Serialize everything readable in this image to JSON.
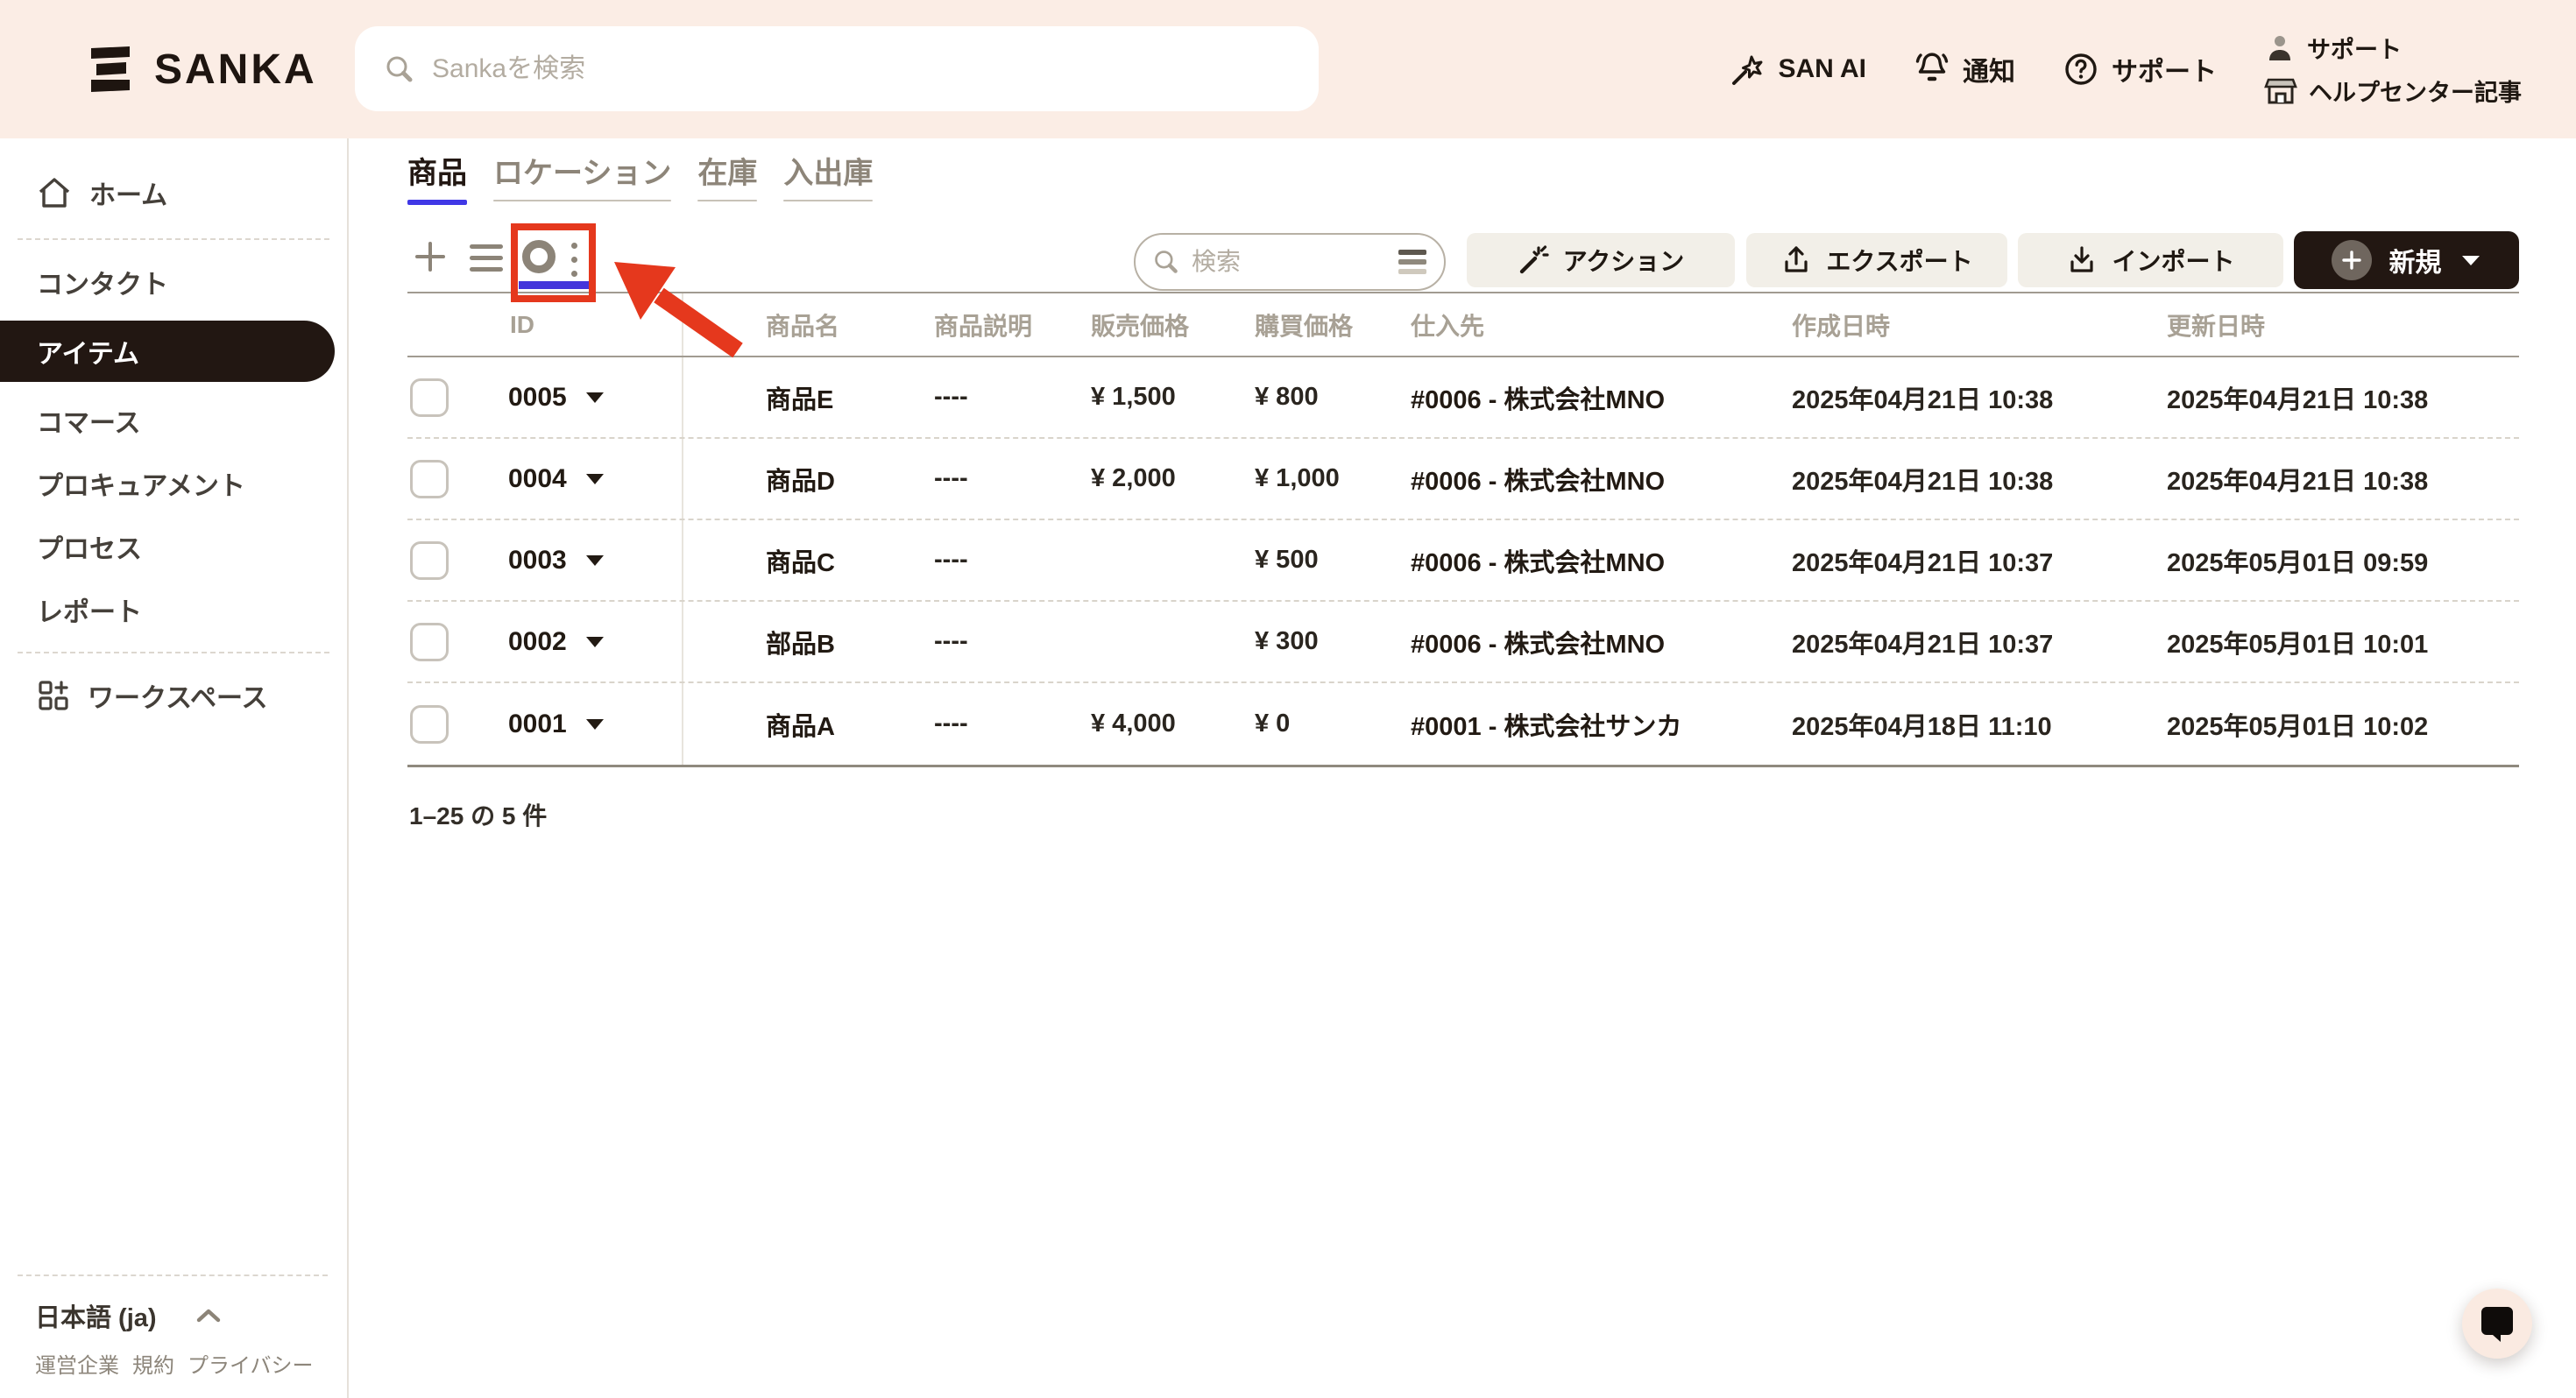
{
  "brand": {
    "name": "SANKA"
  },
  "header": {
    "search_placeholder": "Sankaを検索",
    "nav": [
      {
        "label": "SAN AI",
        "icon": "wand-star-icon"
      },
      {
        "label": "通知",
        "icon": "bell-icon"
      },
      {
        "label": "サポート",
        "icon": "question-circle-icon"
      }
    ],
    "support_group": {
      "top": "サポート",
      "bottom": "ヘルプセンター記事"
    }
  },
  "sidebar": {
    "items": [
      {
        "label": "ホーム",
        "icon": "home-icon"
      },
      {
        "label": "コンタクト"
      },
      {
        "label": "アイテム",
        "active": true
      },
      {
        "label": "コマース"
      },
      {
        "label": "プロキュアメント"
      },
      {
        "label": "プロセス"
      },
      {
        "label": "レポート"
      },
      {
        "label": "ワークスペース",
        "icon": "workspace-grid-icon"
      }
    ],
    "footer": {
      "language": "日本語 (ja)",
      "links": [
        "運営企業",
        "規約",
        "プライバシー"
      ]
    }
  },
  "tabs": [
    {
      "label": "商品",
      "active": true
    },
    {
      "label": "ロケーション"
    },
    {
      "label": "在庫"
    },
    {
      "label": "入出庫"
    }
  ],
  "toolbar": {
    "search_placeholder": "検索",
    "action_label": "アクション",
    "export_label": "エクスポート",
    "import_label": "インポート",
    "new_label": "新規"
  },
  "table": {
    "columns": [
      "ID",
      "商品名",
      "商品説明",
      "販売価格",
      "購買価格",
      "仕入先",
      "作成日時",
      "更新日時"
    ],
    "rows": [
      {
        "id": "0005",
        "name": "商品E",
        "description": "----",
        "selling_price": "¥ 1,500",
        "purchase_price": "¥ 800",
        "supplier": "#0006 - 株式会社MNO",
        "created_at": "2025年04月21日 10:38",
        "updated_at": "2025年04月21日 10:38"
      },
      {
        "id": "0004",
        "name": "商品D",
        "description": "----",
        "selling_price": "¥ 2,000",
        "purchase_price": "¥ 1,000",
        "supplier": "#0006 - 株式会社MNO",
        "created_at": "2025年04月21日 10:38",
        "updated_at": "2025年04月21日 10:38"
      },
      {
        "id": "0003",
        "name": "商品C",
        "description": "----",
        "selling_price": "",
        "purchase_price": "¥ 500",
        "supplier": "#0006 - 株式会社MNO",
        "created_at": "2025年04月21日 10:37",
        "updated_at": "2025年05月01日 09:59"
      },
      {
        "id": "0002",
        "name": "部品B",
        "description": "----",
        "selling_price": "",
        "purchase_price": "¥ 300",
        "supplier": "#0006 - 株式会社MNO",
        "created_at": "2025年04月21日 10:37",
        "updated_at": "2025年05月01日 10:01"
      },
      {
        "id": "0001",
        "name": "商品A",
        "description": "----",
        "selling_price": "¥ 4,000",
        "purchase_price": "¥ 0",
        "supplier": "#0001 - 株式会社サンカ",
        "created_at": "2025年04月18日 11:10",
        "updated_at": "2025年05月01日 10:02"
      }
    ]
  },
  "pagination": {
    "summary": "1–25 の 5 件"
  },
  "annotation": {
    "highlight": "grid-view toggle highlighted with red box and arrow"
  },
  "colors": {
    "header_bg": "#FBEDE5",
    "dark": "#221712",
    "accent_indigo": "#4038E6",
    "accent_red": "#E5381D",
    "button_beige": "#F2EFE8"
  }
}
